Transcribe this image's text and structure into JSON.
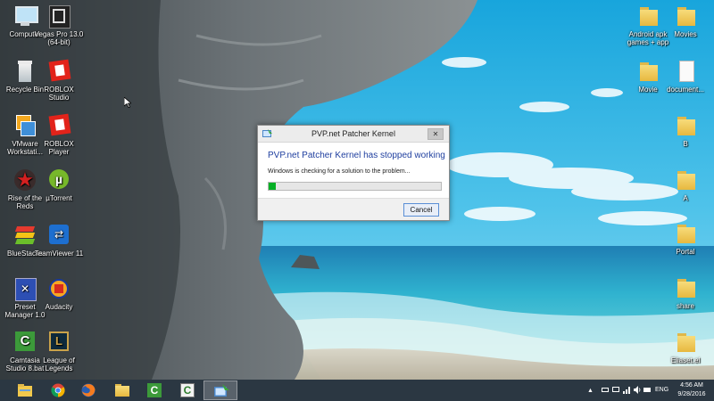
{
  "desktop": {
    "left_icons": [
      {
        "label": "Computer",
        "icon": "computer-icon"
      },
      {
        "label": "Vegas Pro 13.0 (64-bit)",
        "icon": "vegas-pro-icon"
      },
      {
        "label": "Recycle Bin",
        "icon": "recycle-bin-icon"
      },
      {
        "label": "ROBLOX Studio",
        "icon": "roblox-studio-icon"
      },
      {
        "label": "VMware Workstati...",
        "icon": "vmware-icon"
      },
      {
        "label": "ROBLOX Player",
        "icon": "roblox-player-icon"
      },
      {
        "label": "Rise of the Reds",
        "icon": "rise-of-the-reds-icon"
      },
      {
        "label": "µTorrent",
        "icon": "utorrent-icon"
      },
      {
        "label": "BlueStacks",
        "icon": "bluestacks-icon"
      },
      {
        "label": "TeamViewer 11",
        "icon": "teamviewer-icon"
      },
      {
        "label": "Preset Manager 1.0",
        "icon": "preset-manager-icon"
      },
      {
        "label": "Audacity",
        "icon": "audacity-icon"
      },
      {
        "label": "Camtasia Studio 8.bat",
        "icon": "camtasia-icon"
      },
      {
        "label": "League of Legends",
        "icon": "league-of-legends-icon"
      }
    ],
    "right_icons": [
      {
        "label": "Android apk games + app",
        "icon": "folder-icon"
      },
      {
        "label": "Movies",
        "icon": "folder-icon"
      },
      {
        "label": "Movie",
        "icon": "folder-icon"
      },
      {
        "label": "document...",
        "icon": "document-icon"
      },
      {
        "label": "B",
        "icon": "folder-icon"
      },
      {
        "label": "A",
        "icon": "folder-icon"
      },
      {
        "label": "Portal",
        "icon": "folder-icon"
      },
      {
        "label": "share",
        "icon": "folder-icon"
      },
      {
        "label": "Eliaset.el",
        "icon": "folder-icon"
      }
    ]
  },
  "dialog": {
    "title": "PVP.net Patcher Kernel",
    "close_label": "✕",
    "heading": "PVP.net Patcher Kernel has stopped working",
    "message": "Windows is checking for a solution to the problem...",
    "progress_fraction": 0.04,
    "cancel_label": "Cancel"
  },
  "taskbar": {
    "pinned": [
      {
        "icon": "file-explorer-icon",
        "active": false
      },
      {
        "icon": "chrome-icon",
        "active": false
      },
      {
        "icon": "firefox-icon",
        "active": false
      },
      {
        "icon": "folder-icon",
        "active": false
      },
      {
        "icon": "camtasia-icon",
        "active": false
      },
      {
        "icon": "camtasia-recorder-icon",
        "active": false
      },
      {
        "icon": "error-reporting-icon",
        "active": true
      }
    ],
    "tray": {
      "language": "ENG",
      "time": "4:56 AM",
      "date": "9/28/2016"
    }
  },
  "colors": {
    "dialog_heading": "#1f3f9f",
    "progress_fill": "#06b025",
    "taskbar_bg": "#2b3742"
  }
}
